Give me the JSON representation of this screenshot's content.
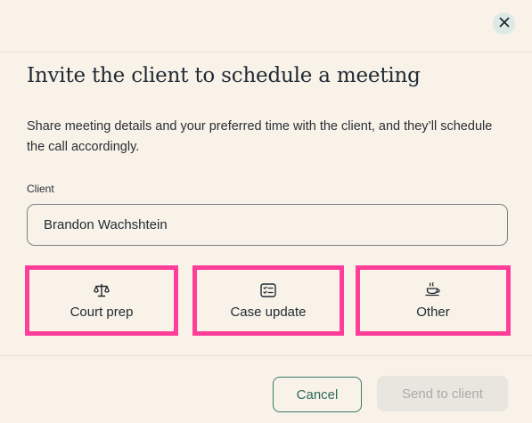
{
  "dialog": {
    "title": "Invite the client to schedule a meeting",
    "description": "Share meeting details and your preferred time with the client, and they’ll schedule the call accordingly.",
    "close_icon": "close-icon"
  },
  "client_field": {
    "label": "Client",
    "value": "Brandon Wachshtein"
  },
  "meeting_types": [
    {
      "label": "Court prep",
      "icon": "scales-icon"
    },
    {
      "label": "Case update",
      "icon": "checklist-icon"
    },
    {
      "label": "Other",
      "icon": "coffee-cup-icon"
    }
  ],
  "footer": {
    "cancel_label": "Cancel",
    "send_label": "Send to client"
  },
  "colors": {
    "background": "#f8f2e8",
    "accent": "#3d7a6c",
    "highlight": "#ff3e9a",
    "disabled_bg": "#e9e6df",
    "disabled_text": "#a8aba9"
  }
}
